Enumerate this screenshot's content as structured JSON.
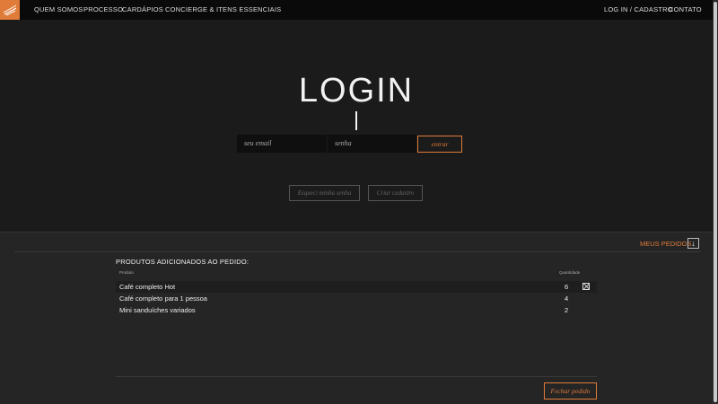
{
  "nav": {
    "items": [
      "QUEM SOMOS",
      "PROCESSO",
      "CARDÁPIOS",
      "CONCIERGE & ITENS ESSENCIAIS"
    ],
    "login_label": "LOG IN / CADASTRO",
    "contact_label": "CONTATO",
    "logo_icon": "brand-logo-icon",
    "accent": "#e07b39"
  },
  "login": {
    "title": "LOGIN",
    "email_placeholder": "seu email",
    "password_placeholder": "senha",
    "enter_label": "entrar",
    "forgot_label": "Esqueci minha senha",
    "register_label": "Criar cadastro"
  },
  "orders": {
    "toggle_label": "MEUS PEDIDOS",
    "toggle_icon": "arrow-down-icon",
    "heading": "PRODUTOS ADICIONADOS AO PEDIDO:",
    "col_product": "Produto",
    "col_qty": "Quantidade",
    "items": [
      {
        "name": "Café completo Hot",
        "qty": "6"
      },
      {
        "name": "Café completo para 1 pessoa",
        "qty": "4"
      },
      {
        "name": "Mini sanduíches variados",
        "qty": "2"
      }
    ],
    "close_label": "Fechar pedido"
  }
}
